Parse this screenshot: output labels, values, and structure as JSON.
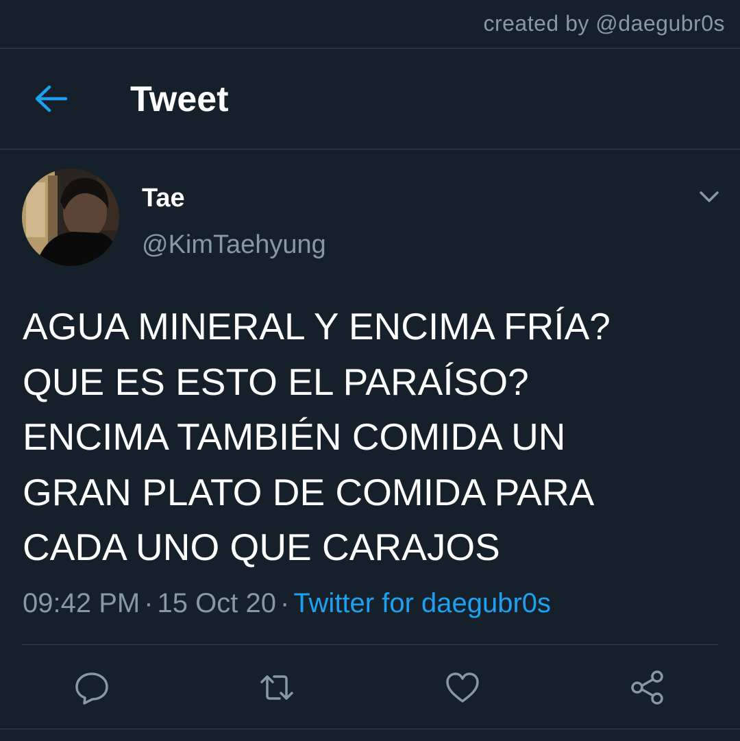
{
  "credit": "created by @daegubr0s",
  "header": {
    "title": "Tweet",
    "back_icon": "arrow-left-icon"
  },
  "user": {
    "display_name": "Tae",
    "handle": "@KimTaehyung"
  },
  "tweet": {
    "lines": [
      "AGUA MINERAL Y ENCIMA FRÍA?",
      "QUE ES ESTO EL PARAÍSO?",
      "ENCIMA TAMBIÉN COMIDA UN",
      "GRAN PLATO DE COMIDA PARA",
      "CADA UNO QUE CARAJOS"
    ],
    "time": "09:42 PM",
    "separator": "·",
    "date": "15 Oct 20",
    "source": "Twitter for daegubr0s"
  },
  "actions": [
    "reply-icon",
    "retweet-icon",
    "like-icon",
    "share-icon"
  ],
  "colors": {
    "background": "#15202b",
    "accent": "#1da1f2",
    "secondary_text": "#8899a6",
    "divider": "#38444d",
    "primary_text": "#ffffff"
  }
}
